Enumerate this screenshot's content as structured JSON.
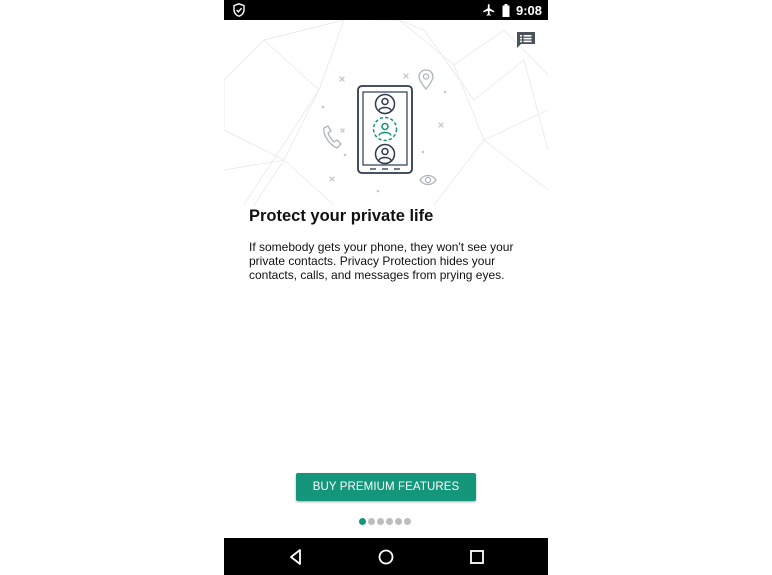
{
  "status_bar": {
    "time": "9:08",
    "icons": [
      "shield-check-icon",
      "airplane-mode-icon",
      "battery-icon"
    ]
  },
  "toolbar": {
    "icons": [
      "messages-icon"
    ]
  },
  "onboarding": {
    "title": "Protect your private life",
    "description": "If somebody gets your phone, they won't see your private contacts. Privacy Protection hides your contacts, calls, and messages from prying eyes.",
    "illustration_icons": [
      "phone-contacts-illustration",
      "location-pin-icon",
      "phone-call-icon",
      "eye-icon"
    ],
    "button_label": "BUY PREMIUM FEATURES",
    "pagination": {
      "total": 6,
      "current": 1
    }
  },
  "colors": {
    "accent": "#14967a",
    "illustration_outline": "#2d3a4f",
    "dot_inactive": "#bdbdbd",
    "decor_gray": "#c4c9cf"
  },
  "nav_bar": {
    "buttons": [
      "back-icon",
      "home-icon",
      "recents-icon"
    ]
  }
}
